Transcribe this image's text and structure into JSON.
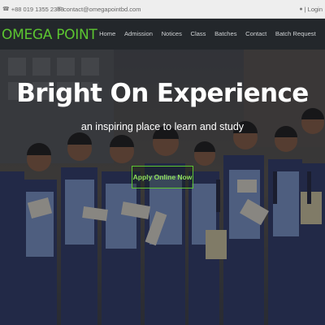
{
  "topbar": {
    "phone_icon": "phone-icon",
    "phone": "+88 019 1355 2388",
    "email_icon": "envelope-icon",
    "email": "contact@omegapointbd.com",
    "login_icon": "user-icon",
    "login_label": "| Login"
  },
  "navbar": {
    "brand": "OMEGA POINT",
    "links": [
      {
        "label": "Home"
      },
      {
        "label": "Admission"
      },
      {
        "label": "Notices"
      },
      {
        "label": "Class"
      },
      {
        "label": "Batches"
      },
      {
        "label": "Contact"
      },
      {
        "label": "Batch Request"
      }
    ]
  },
  "hero": {
    "title": "Bright On Experience",
    "subtitle": "an inspiring place to learn and study",
    "cta_label": "Apply Online Now"
  },
  "colors": {
    "brand_green": "#5cc531",
    "navbar_bg": "#23272b",
    "topbar_bg": "#eeeeee"
  }
}
